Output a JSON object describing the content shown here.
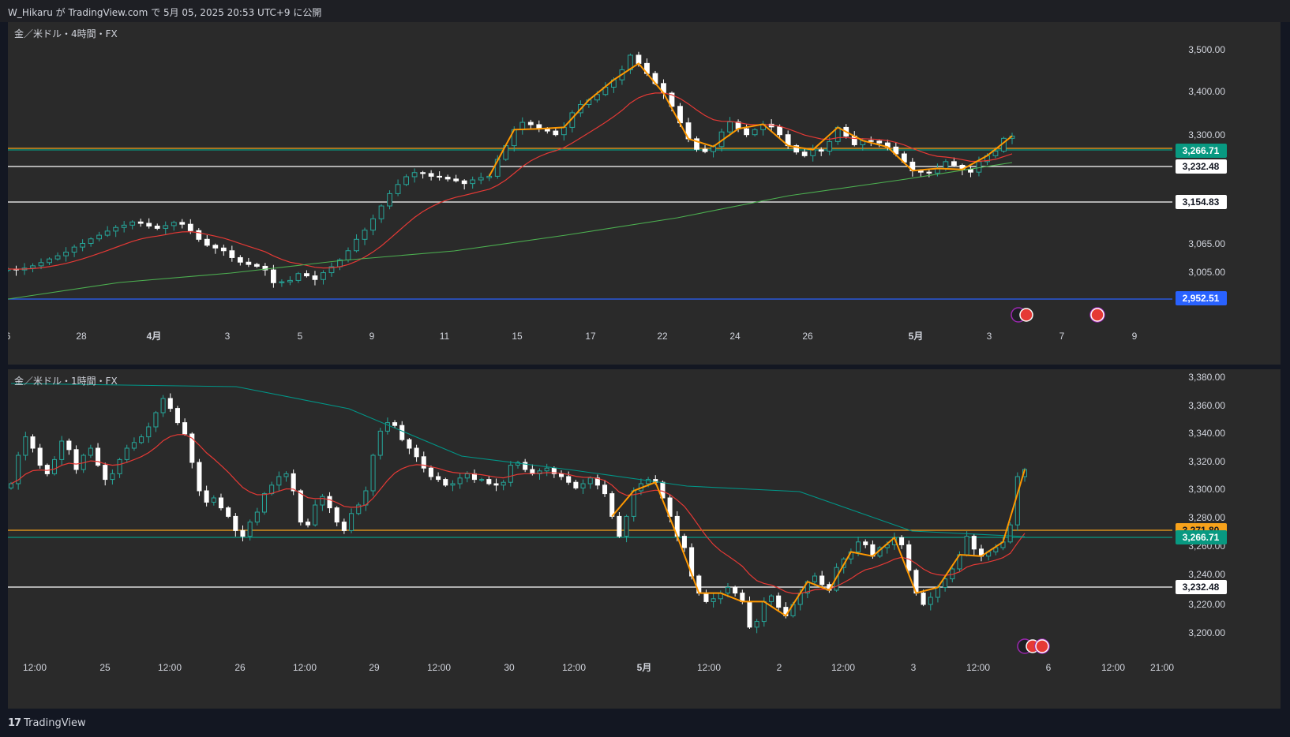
{
  "header": {
    "title": "W_Hikaru が TradingView.com で 5月 05, 2025 20:53 UTC+9 に公開"
  },
  "footer": {
    "brand": "TradingView"
  },
  "colors": {
    "up": "#26a69a",
    "down": "#ffffff",
    "ma_fast": "#e53935",
    "ma_slow": "#4caf50",
    "ma_slow2": "#009688",
    "zigzag": "#ff9800",
    "bg": "#2a2a2a"
  },
  "icons": [
    "events-icon",
    "us-flag-icon",
    "flash-icon"
  ],
  "charts": [
    {
      "title": "金／米ドル・4時間・FX",
      "y_ticks": [
        "3,500.00",
        "3,400.00",
        "3,300.00",
        "3,065.00",
        "3,005.00"
      ],
      "x_ticks": [
        "6",
        "28",
        "4月",
        "3",
        "5",
        "9",
        "11",
        "15",
        "17",
        "22",
        "24",
        "26",
        "5月",
        "3",
        "7",
        "9"
      ],
      "price_labels": [
        {
          "value": "3,266.71",
          "bg": "#089981",
          "fg": "#ffffff"
        },
        {
          "value": "3,232.48",
          "bg": "#ffffff",
          "fg": "#131722"
        },
        {
          "value": "3,154.83",
          "bg": "#ffffff",
          "fg": "#131722"
        },
        {
          "value": "2,952.51",
          "bg": "#2962ff",
          "fg": "#ffffff"
        }
      ]
    },
    {
      "title": "金／米ドル・1時間・FX",
      "y_ticks": [
        "3,380.00",
        "3,360.00",
        "3,340.00",
        "3,320.00",
        "3,300.00",
        "3,280.00",
        "3,260.00",
        "3,240.00",
        "3,220.00",
        "3,200.00"
      ],
      "x_ticks": [
        "12:00",
        "25",
        "12:00",
        "26",
        "12:00",
        "29",
        "12:00",
        "30",
        "12:00",
        "5月",
        "12:00",
        "2",
        "12:00",
        "3",
        "12:00",
        "6",
        "12:00",
        "21:00"
      ],
      "price_labels": [
        {
          "value": "3,271.80",
          "bg": "#f7a21b",
          "fg": "#131722"
        },
        {
          "value": "3,266.71",
          "bg": "#089981",
          "fg": "#ffffff"
        },
        {
          "value": "3,232.48",
          "bg": "#ffffff",
          "fg": "#131722"
        }
      ]
    }
  ],
  "chart_data": [
    {
      "type": "candlestick",
      "title": "金／米ドル・4時間・FX",
      "ylim": [
        2952.51,
        3500
      ],
      "x_ticks": [
        "6",
        "28",
        "4月",
        "3",
        "5",
        "9",
        "11",
        "15",
        "17",
        "22",
        "24",
        "26",
        "5月",
        "3",
        "7",
        "9"
      ],
      "last_price": 3266.71,
      "horizontal_lines": [
        3271.8,
        3266.71,
        3232.48,
        3154.83,
        2952.51
      ],
      "close": [
        3020,
        3018,
        3022,
        3027,
        3034,
        3042,
        3049,
        3057,
        3068,
        3076,
        3086,
        3094,
        3103,
        3111,
        3116,
        3123,
        3120,
        3114,
        3109,
        3115,
        3122,
        3118,
        3104,
        3085,
        3072,
        3066,
        3060,
        3045,
        3035,
        3030,
        3026,
        3018,
        2990,
        2992,
        2995,
        3010,
        3005,
        2997,
        3012,
        3025,
        3040,
        3060,
        3085,
        3105,
        3130,
        3158,
        3185,
        3205,
        3222,
        3231,
        3229,
        3223,
        3221,
        3217,
        3213,
        3207,
        3215,
        3220,
        3223,
        3260,
        3290,
        3325,
        3341,
        3336,
        3327,
        3322,
        3314,
        3330,
        3362,
        3380,
        3390,
        3402,
        3418,
        3434,
        3456,
        3488,
        3470,
        3448,
        3426,
        3405,
        3376,
        3340,
        3305,
        3282,
        3277,
        3288,
        3320,
        3342,
        3327,
        3314,
        3325,
        3337,
        3331,
        3314,
        3290,
        3276,
        3268,
        3281,
        3278,
        3299,
        3330,
        3311,
        3292,
        3301,
        3300,
        3296,
        3287,
        3272,
        3254,
        3235,
        3232,
        3230,
        3240,
        3255,
        3247,
        3238,
        3232,
        3255,
        3268,
        3278,
        3306,
        3311
      ]
    },
    {
      "type": "candlestick",
      "title": "金／米ドル・1時間・FX",
      "ylim": [
        3200,
        3380
      ],
      "x_ticks": [
        "12:00",
        "25",
        "12:00",
        "26",
        "12:00",
        "29",
        "12:00",
        "30",
        "12:00",
        "5月",
        "12:00",
        "2",
        "12:00",
        "3",
        "12:00",
        "6",
        "12:00",
        "21:00"
      ],
      "last_price": 3266.71,
      "horizontal_lines": [
        3271.8,
        3266.71,
        3232.48
      ],
      "close": [
        3305,
        3325,
        3338,
        3330,
        3318,
        3312,
        3322,
        3335,
        3329,
        3315,
        3325,
        3330,
        3318,
        3308,
        3312,
        3322,
        3330,
        3334,
        3338,
        3345,
        3355,
        3365,
        3358,
        3348,
        3340,
        3320,
        3300,
        3292,
        3295,
        3288,
        3282,
        3272,
        3268,
        3278,
        3285,
        3298,
        3304,
        3310,
        3312,
        3300,
        3278,
        3276,
        3290,
        3296,
        3288,
        3278,
        3272,
        3284,
        3290,
        3300,
        3325,
        3342,
        3348,
        3346,
        3336,
        3330,
        3324,
        3316,
        3310,
        3308,
        3304,
        3305,
        3309,
        3312,
        3308,
        3308,
        3305,
        3304,
        3306,
        3318,
        3320,
        3315,
        3312,
        3314,
        3316,
        3312,
        3310,
        3306,
        3302,
        3305,
        3309,
        3304,
        3298,
        3282,
        3268,
        3282,
        3300,
        3305,
        3308,
        3306,
        3295,
        3282,
        3268,
        3260,
        3240,
        3228,
        3222,
        3224,
        3228,
        3232,
        3228,
        3222,
        3204,
        3208,
        3222,
        3226,
        3218,
        3212,
        3220,
        3228,
        3236,
        3240,
        3234,
        3230,
        3246,
        3252,
        3257,
        3264,
        3262,
        3254,
        3260,
        3262,
        3267,
        3262,
        3244,
        3228,
        3220,
        3225,
        3232,
        3238,
        3245,
        3255,
        3268,
        3259,
        3254,
        3257,
        3260,
        3264,
        3276,
        3310,
        3315
      ]
    }
  ]
}
